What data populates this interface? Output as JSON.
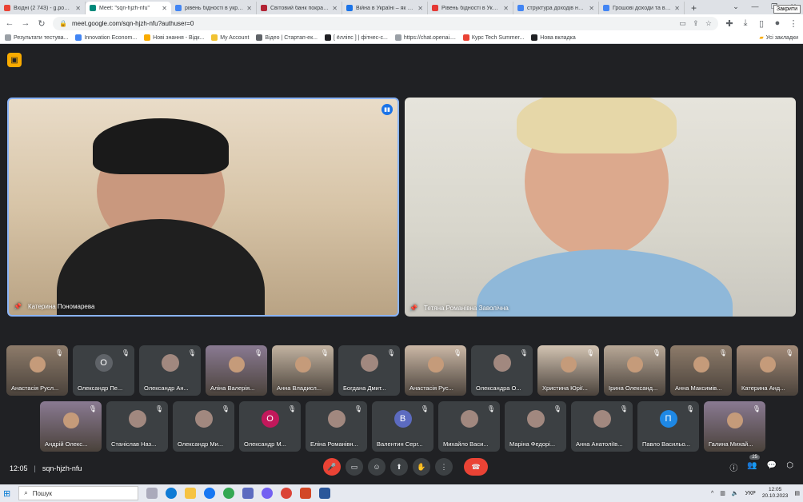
{
  "browser": {
    "tabs": [
      {
        "title": "Вхідні (2 743) - g.pochen...",
        "color": "#ea4335"
      },
      {
        "title": "Meet: \"sqn-hjzh-nfu\"",
        "color": "#00897b",
        "active": true
      },
      {
        "title": "рівень бідності в україн",
        "color": "#4285f4"
      },
      {
        "title": "Світовий банк покращ...",
        "color": "#b22234"
      },
      {
        "title": "Війна в Україні – як за р",
        "color": "#1a73e8"
      },
      {
        "title": "Рівень бідності в Україн",
        "color": "#e53935"
      },
      {
        "title": "структура доходів насел",
        "color": "#4285f4"
      },
      {
        "title": "Грошові доходи та витр",
        "color": "#4285f4"
      }
    ],
    "close_tooltip": "Закрити",
    "url": "meet.google.com/sqn-hjzh-nfu?authuser=0",
    "bookmarks": [
      "Результати тестува...",
      "Innovation Econom...",
      "Нові знання - Відк...",
      "My Account",
      "Відео | Стартап-ек...",
      "[ ёлліпс ] | фітнес-с...",
      "https://chat.openai....",
      "Курс Tech Summer...",
      "Нова вкладка"
    ],
    "all_bookmarks": "Усі закладки"
  },
  "meet": {
    "main_tiles": [
      {
        "name": "Катерина Пономарева"
      },
      {
        "name": "Тетяна Романівна Заволічна"
      }
    ],
    "participants_row1": [
      {
        "name": "Анастасія Русл...",
        "type": "video"
      },
      {
        "name": "Олександр Пе...",
        "type": "avatar",
        "initial": "О",
        "color": "#5f6368"
      },
      {
        "name": "Олександр Ан...",
        "type": "photo"
      },
      {
        "name": "Аліна Валерія...",
        "type": "video"
      },
      {
        "name": "Анна Владисл...",
        "type": "video"
      },
      {
        "name": "Богдана Дмит...",
        "type": "photo"
      },
      {
        "name": "Анастасія Рус...",
        "type": "video"
      },
      {
        "name": "Олександра О...",
        "type": "photo"
      },
      {
        "name": "Христина Юрії...",
        "type": "video"
      },
      {
        "name": "Ірина Олександ...",
        "type": "video"
      },
      {
        "name": "Анна Максимів...",
        "type": "video"
      },
      {
        "name": "Катерина Анд...",
        "type": "video"
      }
    ],
    "participants_row2": [
      {
        "name": "Андрій Олекс...",
        "type": "video"
      },
      {
        "name": "Станіслав Наз...",
        "type": "photo"
      },
      {
        "name": "Олександр Ми...",
        "type": "photo"
      },
      {
        "name": "Олександр М...",
        "type": "avatar",
        "initial": "О",
        "color": "#c2185b"
      },
      {
        "name": "Еліна Романівн...",
        "type": "photo"
      },
      {
        "name": "Валентин Серг...",
        "type": "avatar",
        "initial": "В",
        "color": "#5c6bc0"
      },
      {
        "name": "Михайло Васи...",
        "type": "photo"
      },
      {
        "name": "Маріна Федорі...",
        "type": "photo"
      },
      {
        "name": "Анна Анатоліїв...",
        "type": "photo"
      },
      {
        "name": "Павло Васильо...",
        "type": "avatar",
        "initial": "П",
        "color": "#1e88e5"
      },
      {
        "name": "Галина Михай...",
        "type": "video"
      }
    ],
    "time": "12:05",
    "meeting_code": "sqn-hjzh-nfu",
    "participants_count": "25"
  },
  "taskbar": {
    "search_placeholder": "Пошук",
    "language": "УКР",
    "clock_time": "12:05",
    "clock_date": "20.10.2023"
  }
}
